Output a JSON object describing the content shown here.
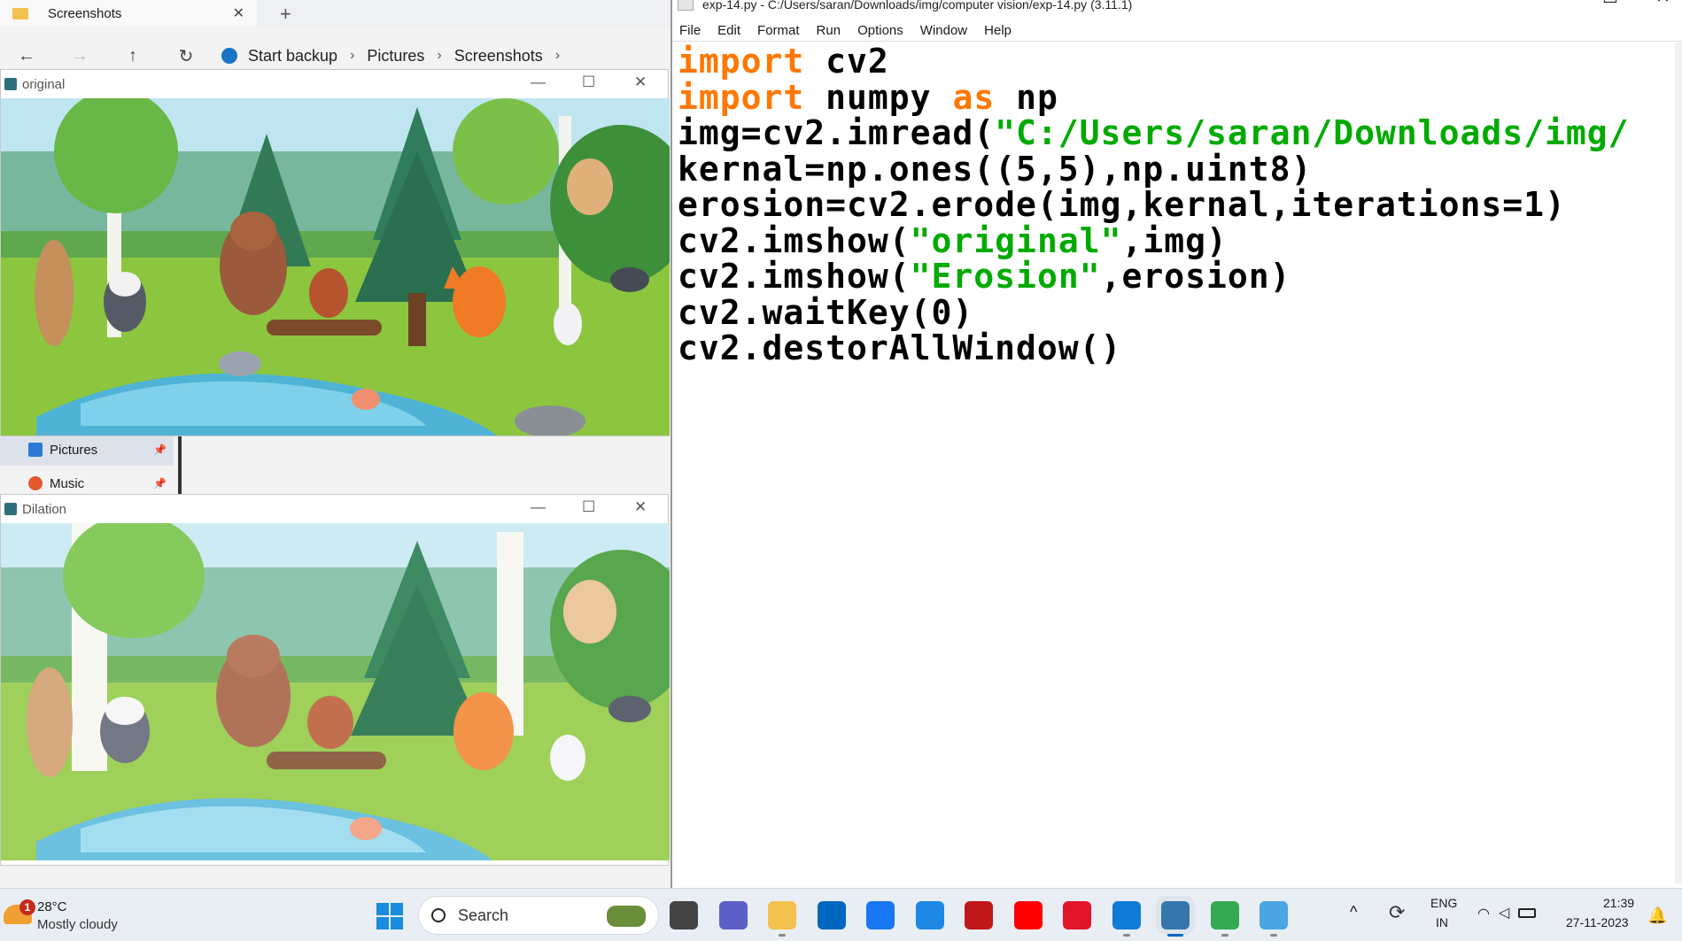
{
  "explorer": {
    "tab_title": "Screenshots",
    "tab_close": "✕",
    "new_tab": "+",
    "nav": {
      "back": "←",
      "forward": "→",
      "up": "↑",
      "refresh": "↻"
    },
    "breadcrumb": [
      "Start backup",
      "Pictures",
      "Screenshots"
    ],
    "sidebar": [
      {
        "label": "Pictures",
        "pin": "📌"
      },
      {
        "label": "Music",
        "pin": "📌"
      }
    ]
  },
  "windows": {
    "original": {
      "title": "original",
      "min": "—",
      "max": "☐",
      "close": "✕"
    },
    "dilation": {
      "title": "Dilation",
      "min": "—",
      "max": "☐",
      "close": "✕"
    }
  },
  "idle": {
    "title": "exp-14.py - C:/Users/saran/Downloads/img/computer vision/exp-14.py (3.11.1)",
    "menu": [
      "File",
      "Edit",
      "Format",
      "Run",
      "Options",
      "Window",
      "Help"
    ],
    "win_controls": {
      "min": "—",
      "max": "☐",
      "close": "✕"
    },
    "code": [
      [
        {
          "t": "import",
          "c": "kw"
        },
        {
          "t": " cv2",
          "c": ""
        }
      ],
      [
        {
          "t": "import",
          "c": "kw"
        },
        {
          "t": " numpy ",
          "c": ""
        },
        {
          "t": "as",
          "c": "kw"
        },
        {
          "t": " np",
          "c": ""
        }
      ],
      [
        {
          "t": "img=cv2.imread(",
          "c": ""
        },
        {
          "t": "\"C:/Users/saran/Downloads/img/",
          "c": "str"
        }
      ],
      [
        {
          "t": "kernal=np.ones((5,5),np.uint8)",
          "c": ""
        }
      ],
      [
        {
          "t": "erosion=cv2.erode(img,kernal,iterations=1)",
          "c": ""
        }
      ],
      [
        {
          "t": "cv2.imshow(",
          "c": ""
        },
        {
          "t": "\"original\"",
          "c": "str"
        },
        {
          "t": ",img)",
          "c": ""
        }
      ],
      [
        {
          "t": "cv2.imshow(",
          "c": ""
        },
        {
          "t": "\"Erosion\"",
          "c": "str"
        },
        {
          "t": ",erosion)",
          "c": ""
        }
      ],
      [
        {
          "t": "cv2.waitKey(0)",
          "c": ""
        }
      ],
      [
        {
          "t": "cv2.destorAllWindow()",
          "c": ""
        }
      ]
    ]
  },
  "taskbar": {
    "weather": {
      "temp": "28°C",
      "desc": "Mostly cloudy",
      "badge": "1"
    },
    "search_placeholder": "Search",
    "apps": [
      {
        "name": "task-view-icon",
        "color": "#444444"
      },
      {
        "name": "teams-chat-icon",
        "color": "#5b5fc7"
      },
      {
        "name": "file-explorer-icon",
        "color": "#f2c14e",
        "open": true
      },
      {
        "name": "microsoft-store-icon",
        "color": "#0067c0"
      },
      {
        "name": "facebook-icon",
        "color": "#1877f2"
      },
      {
        "name": "messenger-icon",
        "color": "#1e88e5"
      },
      {
        "name": "mcafee-icon",
        "color": "#c01818"
      },
      {
        "name": "youtube-icon",
        "color": "#ff0000"
      },
      {
        "name": "opera-icon",
        "color": "#e0142a"
      },
      {
        "name": "edge-icon",
        "color": "#0f7bd6",
        "open": true
      },
      {
        "name": "python-idle-icon",
        "color": "#3776ab",
        "open": true,
        "active": true
      },
      {
        "name": "chrome-icon",
        "color": "#34a853",
        "open": true
      },
      {
        "name": "snipping-tool-icon",
        "color": "#4aa5e0",
        "open": true
      }
    ],
    "tray": {
      "chevron": "^",
      "lang_top": "ENG",
      "lang_bottom": "IN",
      "time": "21:39",
      "date": "27-11-2023"
    }
  }
}
